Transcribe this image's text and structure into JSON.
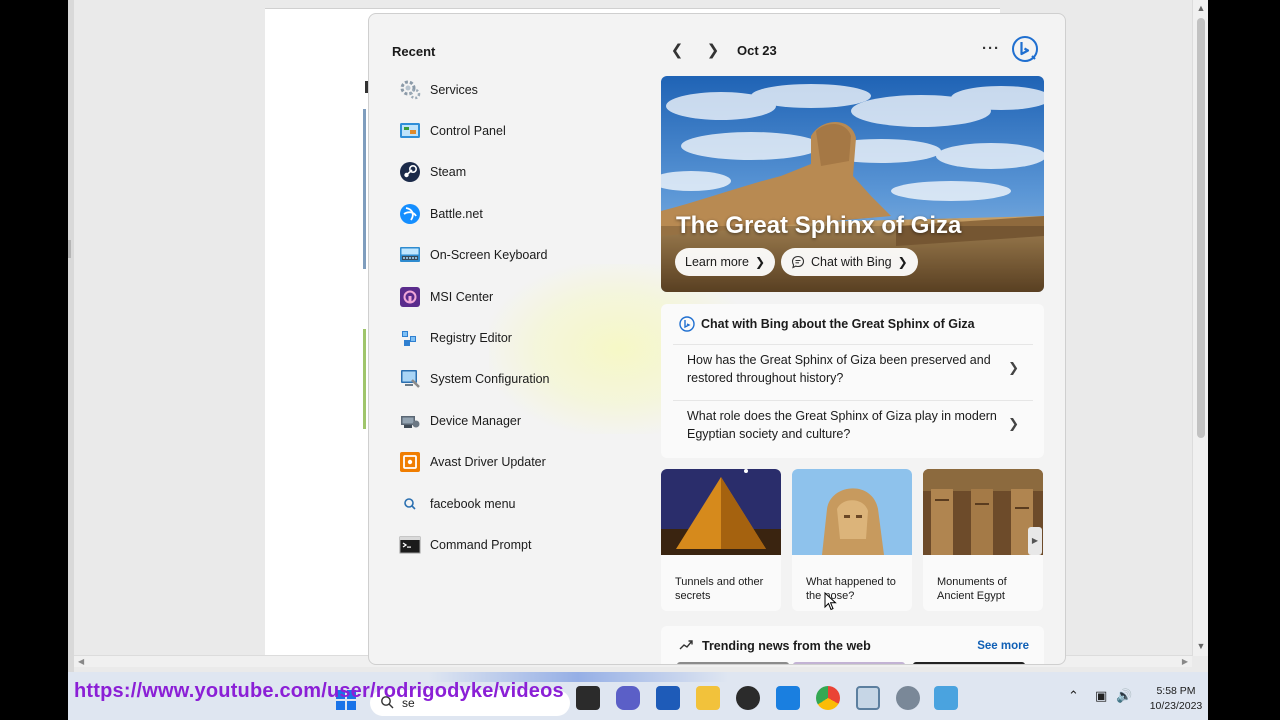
{
  "recent": {
    "title": "Recent",
    "items": [
      {
        "label": "Services",
        "icon": "services-icon"
      },
      {
        "label": "Control Panel",
        "icon": "control-panel-icon"
      },
      {
        "label": "Steam",
        "icon": "steam-icon"
      },
      {
        "label": "Battle.net",
        "icon": "battlenet-icon"
      },
      {
        "label": "On-Screen Keyboard",
        "icon": "keyboard-icon"
      },
      {
        "label": "MSI Center",
        "icon": "msi-center-icon"
      },
      {
        "label": "Registry Editor",
        "icon": "registry-editor-icon"
      },
      {
        "label": "System Configuration",
        "icon": "system-configuration-icon"
      },
      {
        "label": "Device Manager",
        "icon": "device-manager-icon"
      },
      {
        "label": "Avast Driver Updater",
        "icon": "avast-driver-updater-icon"
      },
      {
        "label": "facebook menu",
        "icon": "search-icon"
      },
      {
        "label": "Command Prompt",
        "icon": "command-prompt-icon"
      }
    ]
  },
  "header": {
    "date": "Oct 23",
    "more": "···"
  },
  "hero": {
    "title": "The Great Sphinx of Giza",
    "learn_more": "Learn more",
    "chat_with_bing": "Chat with Bing"
  },
  "chat_card": {
    "title": "Chat with Bing about the Great Sphinx of Giza",
    "questions": [
      "How has the Great Sphinx of Giza been preserved and restored throughout history?",
      "What role does the Great Sphinx of Giza play in modern Egyptian society and culture?"
    ]
  },
  "thumbnails": [
    {
      "caption": "Tunnels and other secrets"
    },
    {
      "caption": "What happened to the nose?"
    },
    {
      "caption": "Monuments of Ancient Egypt"
    }
  ],
  "trending": {
    "title": "Trending news from the web",
    "see_more": "See more"
  },
  "taskbar": {
    "url_overlay": "https://www.youtube.com/user/rodrigodyke/videos",
    "search_text": "se",
    "time": "5:58 PM",
    "date": "10/23/2023"
  },
  "colors": {
    "accent": "#0f5fb5",
    "url_overlay": "#8b1fd6",
    "taskbar": "#dfe6f1",
    "start_bg": "#f3f3f3"
  }
}
